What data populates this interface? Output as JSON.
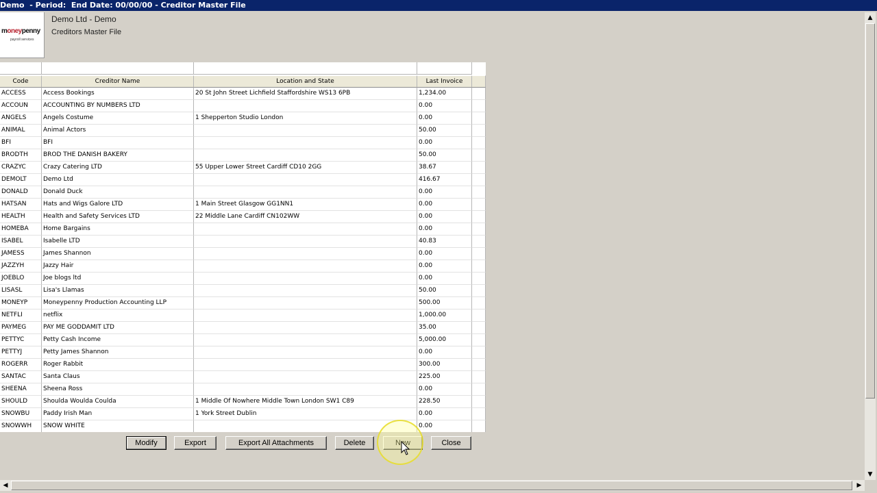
{
  "window": {
    "title": "Demo  - Period:  End Date: 00/00/00 - Creditor Master File"
  },
  "logo": {
    "word_black_1": "m",
    "word_red": "oney",
    "word_black_2": "penny",
    "sub": "payroll services"
  },
  "header": {
    "company": "Demo Ltd - Demo",
    "subtitle": "Creditors Master File"
  },
  "table": {
    "columns": [
      "Code",
      "Creditor Name",
      "Location and State",
      "Last Invoice"
    ],
    "rows": [
      [
        "ACCESS",
        "Access Bookings",
        "20 St John Street Lichfield Staffordshire  WS13 6PB",
        "1,234.00"
      ],
      [
        "ACCOUN",
        "ACCOUNTING BY NUMBERS LTD",
        "",
        "0.00"
      ],
      [
        "ANGELS",
        "Angels Costume",
        "1 Shepperton Studio  London",
        "0.00"
      ],
      [
        "ANIMAL",
        "Animal Actors",
        "",
        "50.00"
      ],
      [
        "BFI",
        "BFI",
        "",
        "0.00"
      ],
      [
        "BRODTH",
        "BROD THE DANISH BAKERY",
        "",
        "50.00"
      ],
      [
        "CRAZYC",
        "Crazy Catering LTD",
        "55 Upper Lower Street  Cardiff  CD10 2GG",
        "38.67"
      ],
      [
        "DEMOLT",
        "Demo Ltd",
        "",
        "416.67"
      ],
      [
        "DONALD",
        "Donald Duck",
        "",
        "0.00"
      ],
      [
        "HATSAN",
        "Hats and Wigs Galore LTD",
        "1 Main Street  Glasgow  GG1NN1",
        "0.00"
      ],
      [
        "HEALTH",
        "Health and Safety Services LTD",
        "22 Middle Lane  Cardiff  CN102WW",
        "0.00"
      ],
      [
        "HOMEBA",
        "Home Bargains",
        "",
        "0.00"
      ],
      [
        "ISABEL",
        "Isabelle LTD",
        "",
        "40.83"
      ],
      [
        "JAMESS",
        "James Shannon",
        "",
        "0.00"
      ],
      [
        "JAZZYH",
        "Jazzy Hair",
        "",
        "0.00"
      ],
      [
        "JOEBLO",
        "Joe blogs ltd",
        "",
        "0.00"
      ],
      [
        "LISASL",
        "Lisa's Llamas",
        "",
        "50.00"
      ],
      [
        "MONEYP",
        "Moneypenny Production Accounting LLP",
        "",
        "500.00"
      ],
      [
        "NETFLI",
        "netflix",
        "",
        "1,000.00"
      ],
      [
        "PAYMEG",
        "PAY ME GODDAMIT LTD",
        "",
        "35.00"
      ],
      [
        "PETTYC",
        "Petty Cash Income",
        "",
        "5,000.00"
      ],
      [
        "PETTYJ",
        "Petty James Shannon",
        "",
        "0.00"
      ],
      [
        "ROGERR",
        "Roger Rabbit",
        "",
        "300.00"
      ],
      [
        "SANTAC",
        "Santa Claus",
        "",
        "225.00"
      ],
      [
        "SHEENA",
        "Sheena Ross",
        "",
        "0.00"
      ],
      [
        "SHOULD",
        "Shoulda Woulda Coulda",
        "1 Middle Of Nowhere Middle Town London  SW1 C89",
        "228.50"
      ],
      [
        "SNOWBU",
        "Paddy Irish Man",
        "1 York Street  Dublin",
        "0.00"
      ],
      [
        "SNOWWH",
        "SNOW WHITE",
        "",
        "0.00"
      ]
    ]
  },
  "buttons": {
    "modify": "Modify",
    "export": "Export",
    "export_all": "Export All Attachments",
    "delete": "Delete",
    "new": "New",
    "close": "Close"
  },
  "scrollbars": {
    "up": "▲",
    "down": "▼",
    "left": "◀",
    "right": "▶"
  }
}
